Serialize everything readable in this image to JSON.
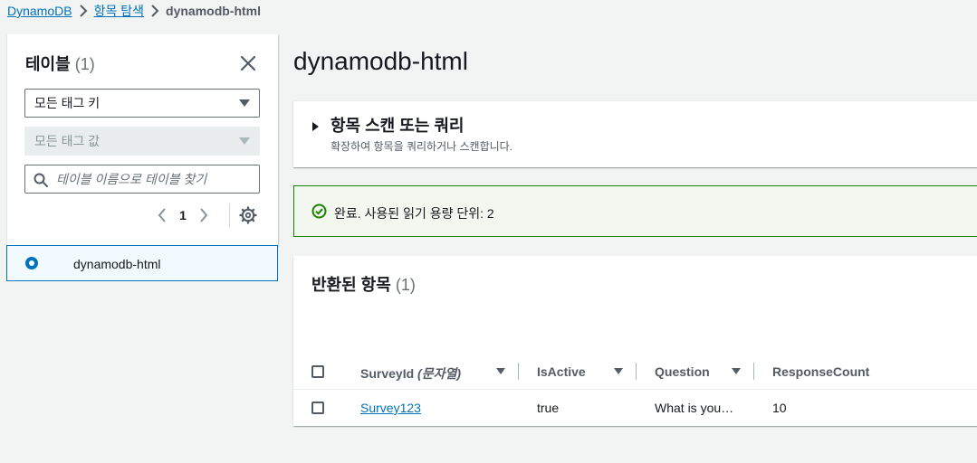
{
  "breadcrumb": {
    "items": [
      "DynamoDB",
      "항목 탐색"
    ],
    "current": "dynamodb-html"
  },
  "sidebar": {
    "title": "테이블",
    "count": "(1)",
    "tag_key_select": "모든 태그 키",
    "tag_value_select": "모든 태그 값",
    "search_placeholder": "테이블 이름으로 테이블 찾기",
    "page": "1",
    "tables": [
      {
        "name": "dynamodb-html",
        "selected": true
      }
    ]
  },
  "main": {
    "title": "dynamodb-html",
    "scan_panel": {
      "title": "항목 스캔 또는 쿼리",
      "description": "확장하여 항목을 쿼리하거나 스캔합니다."
    },
    "alert": {
      "text": "완료. 사용된 읽기 용량 단위: 2",
      "status": "success"
    },
    "results": {
      "title": "반환된 항목",
      "count": "(1)",
      "columns": [
        {
          "label": "SurveyId",
          "type_hint": "(문자열)"
        },
        {
          "label": "IsActive"
        },
        {
          "label": "Question"
        },
        {
          "label": "ResponseCount"
        }
      ],
      "rows": [
        {
          "SurveyId": "Survey123",
          "IsActive": "true",
          "Question": "What is you…",
          "ResponseCount": "10"
        }
      ]
    }
  },
  "colors": {
    "link": "#0073bb",
    "success_border": "#1d8102",
    "success_bg": "#f2f8f0",
    "page_bg": "#f2f3f3"
  },
  "icons": [
    "chevron-right-icon",
    "close-icon",
    "caret-down-icon",
    "search-icon",
    "chevron-left-icon",
    "gear-icon",
    "caret-right-icon",
    "success-icon",
    "sort-icon"
  ]
}
